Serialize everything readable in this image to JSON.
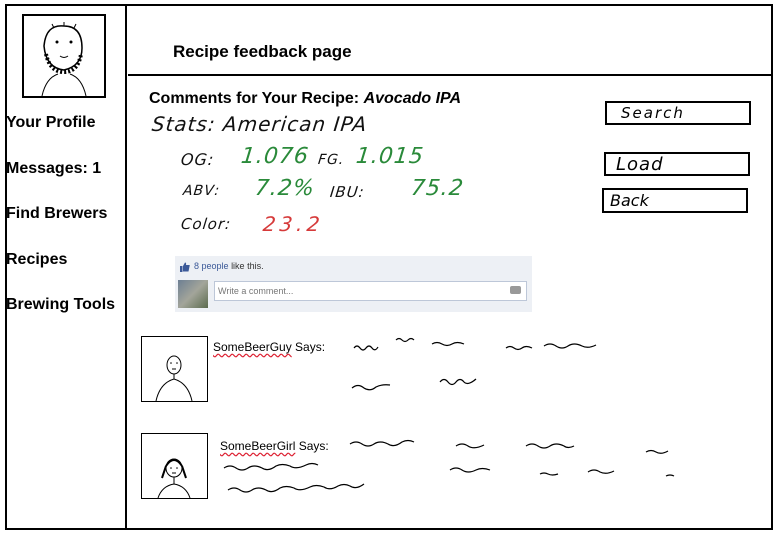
{
  "header": {
    "title": "Recipe feedback page"
  },
  "sidebar": {
    "items": [
      {
        "label": "Your Profile"
      },
      {
        "label": "Messages: 1"
      },
      {
        "label": "Find Brewers"
      },
      {
        "label": "Recipes"
      },
      {
        "label": "Brewing Tools"
      }
    ]
  },
  "recipe": {
    "comments_prefix": "Comments for Your Recipe:",
    "name": "Avocado IPA",
    "stats_line": "Stats: American IPA",
    "og_label": "OG:",
    "og_value": "1.076",
    "fg_label": "FG.",
    "fg_value": "1.015",
    "abv_label": "ABV:",
    "abv_value": "7.2%",
    "ibu_label": "IBU:",
    "ibu_value": "75.2",
    "color_label": "Color:",
    "color_value": "23.2"
  },
  "buttons": {
    "search": "Search",
    "load": "Load",
    "back": "Back"
  },
  "facebook": {
    "like_count_text": "8 people",
    "like_suffix": "like this.",
    "comment_placeholder": "Write a comment..."
  },
  "comments": [
    {
      "author": "SomeBeerGuy",
      "says": "Says:"
    },
    {
      "author": "SomeBeerGirl",
      "says": "Says:"
    }
  ],
  "colors": {
    "green": "#2a8a3a",
    "red": "#d63a3a",
    "fb_blue": "#3b5998"
  }
}
